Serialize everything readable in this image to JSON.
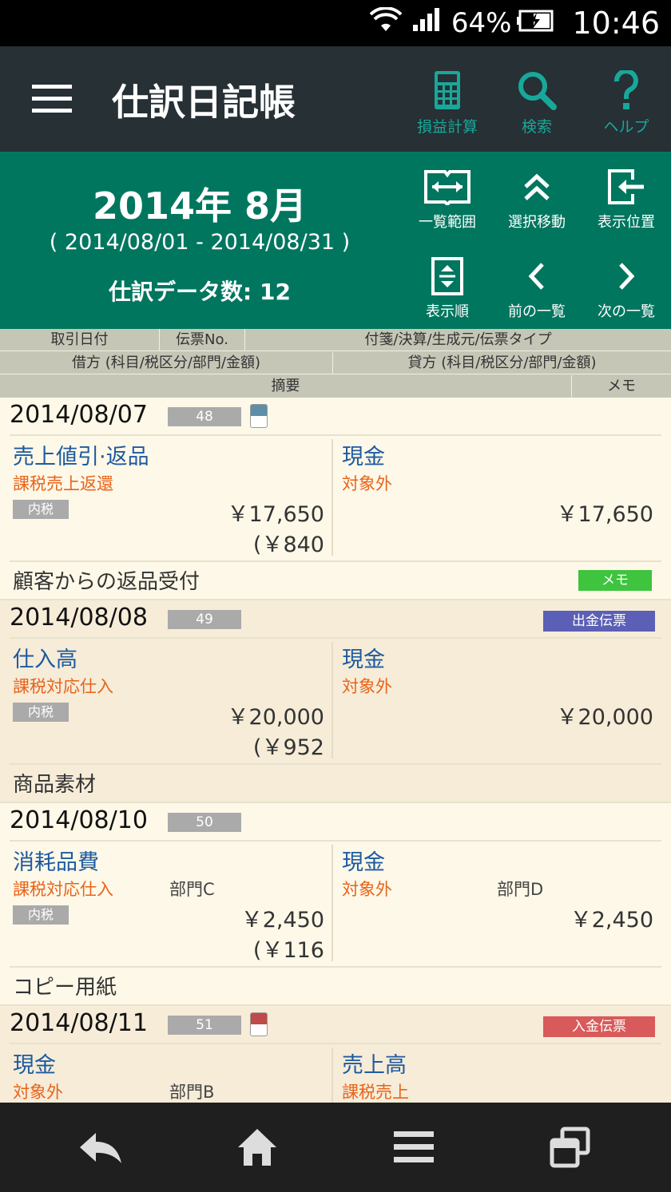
{
  "status_bar": {
    "battery": "64%",
    "time": "10:46"
  },
  "app_bar": {
    "title": "仕訳日記帳",
    "actions": [
      {
        "label": "損益計算",
        "icon": "calculator-icon"
      },
      {
        "label": "検索",
        "icon": "search-icon"
      },
      {
        "label": "ヘルプ",
        "icon": "help-icon"
      }
    ]
  },
  "header": {
    "month": "2014年 8月",
    "range": "( 2014/08/01 - 2014/08/31 )",
    "count": "仕訳データ数: 12",
    "buttons": [
      {
        "label": "一覧範囲",
        "icon": "range-icon"
      },
      {
        "label": "選択移動",
        "icon": "double-chevron-up-icon"
      },
      {
        "label": "表示位置",
        "icon": "position-icon"
      },
      {
        "label": "表示順",
        "icon": "sort-order-icon"
      },
      {
        "label": "前の一覧",
        "icon": "chevron-left-icon"
      },
      {
        "label": "次の一覧",
        "icon": "chevron-right-icon"
      }
    ]
  },
  "columns": {
    "row1": [
      "取引日付",
      "伝票No.",
      "付箋/決算/生成元/伝票タイプ"
    ],
    "row2": [
      "借方 (科目/税区分/部門/金額)",
      "貸方 (科目/税区分/部門/金額)"
    ],
    "row3": [
      "摘要",
      "メモ"
    ]
  },
  "entries": [
    {
      "date": "2014/08/07",
      "voucher": "48",
      "tag": "blue",
      "type": "",
      "debit": {
        "account": "売上値引·返品",
        "tax": "課税売上返還",
        "dept": "",
        "badge": "内税",
        "amount": "￥17,650",
        "tax_amount": "(￥840"
      },
      "credit": {
        "account": "現金",
        "tax": "対象外",
        "dept": "",
        "amount": "￥17,650"
      },
      "memo": "顧客からの返品受付",
      "memo_button": "メモ"
    },
    {
      "date": "2014/08/08",
      "voucher": "49",
      "tag": "",
      "type": "出金伝票",
      "debit": {
        "account": "仕入高",
        "tax": "課税対応仕入",
        "dept": "",
        "badge": "内税",
        "amount": "￥20,000",
        "tax_amount": "(￥952"
      },
      "credit": {
        "account": "現金",
        "tax": "対象外",
        "dept": "",
        "amount": "￥20,000"
      },
      "memo": "商品素材",
      "memo_button": ""
    },
    {
      "date": "2014/08/10",
      "voucher": "50",
      "tag": "",
      "type": "",
      "debit": {
        "account": "消耗品費",
        "tax": "課税対応仕入",
        "dept": "部門C",
        "badge": "内税",
        "amount": "￥2,450",
        "tax_amount": "(￥116"
      },
      "credit": {
        "account": "現金",
        "tax": "対象外",
        "dept": "部門D",
        "amount": "￥2,450"
      },
      "memo": "コピー用紙",
      "memo_button": ""
    },
    {
      "date": "2014/08/11",
      "voucher": "51",
      "tag": "red",
      "type": "入金伝票",
      "debit": {
        "account": "現金",
        "tax": "対象外",
        "dept": "部門B",
        "badge": "",
        "amount": "",
        "tax_amount": ""
      },
      "credit": {
        "account": "売上高",
        "tax": "課税売上",
        "dept": "",
        "amount": ""
      },
      "memo": "",
      "memo_button": ""
    }
  ],
  "colors": {
    "appbar": "#263035",
    "header_green": "#00765f",
    "accent_teal": "#18a89a",
    "account_blue": "#1e5aa0",
    "tax_orange": "#e8631a",
    "withdrawal_voucher": "#5b5fb5",
    "deposit_voucher": "#d85a5a",
    "memo_green": "#3ec43e",
    "tag_blue": "#5d8fa8",
    "tag_red": "#c04a4a"
  }
}
